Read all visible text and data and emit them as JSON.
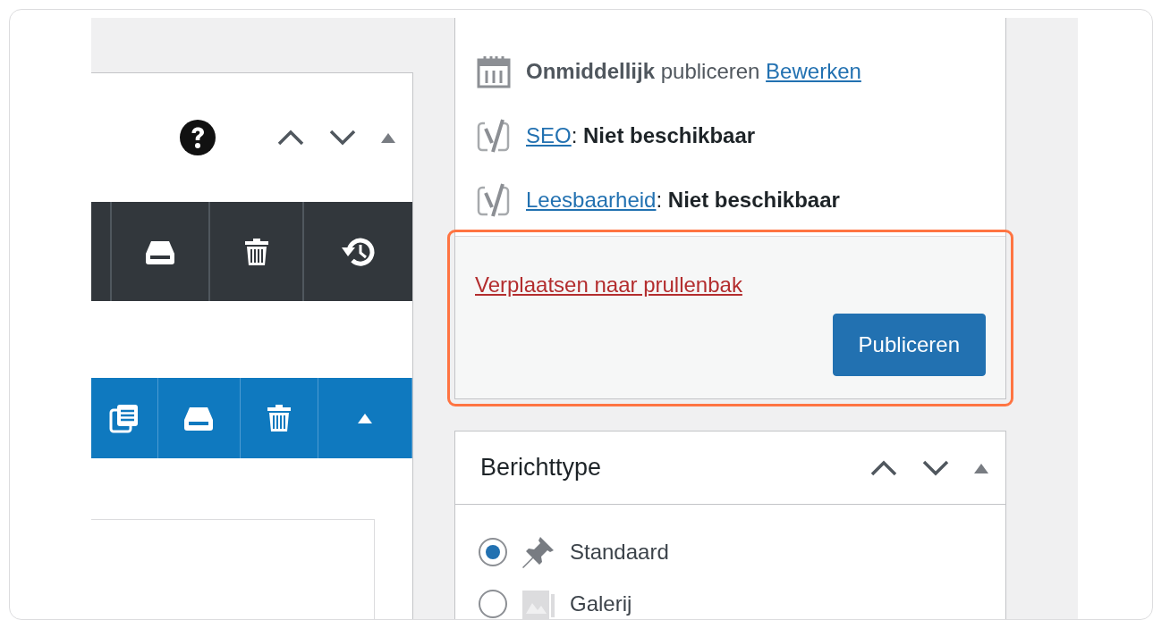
{
  "publish_box": {
    "schedule": {
      "text": "**Onmiddellijk** publiceren",
      "link": "Bewerken"
    },
    "analysis": [
      {
        "link": "SEO",
        "text": ": **Niet beschikbaar**"
      },
      {
        "link": "Leesbaarheid",
        "text": ": **Niet beschikbaar**"
      }
    ],
    "trash_link": "Verplaatsen naar prullenbak",
    "publish_button": "Publiceren"
  },
  "format_box": {
    "title": "Berichttype",
    "options": [
      {
        "label": "Standaard",
        "selected": true
      },
      {
        "label": "Galerij",
        "selected": false
      }
    ]
  }
}
